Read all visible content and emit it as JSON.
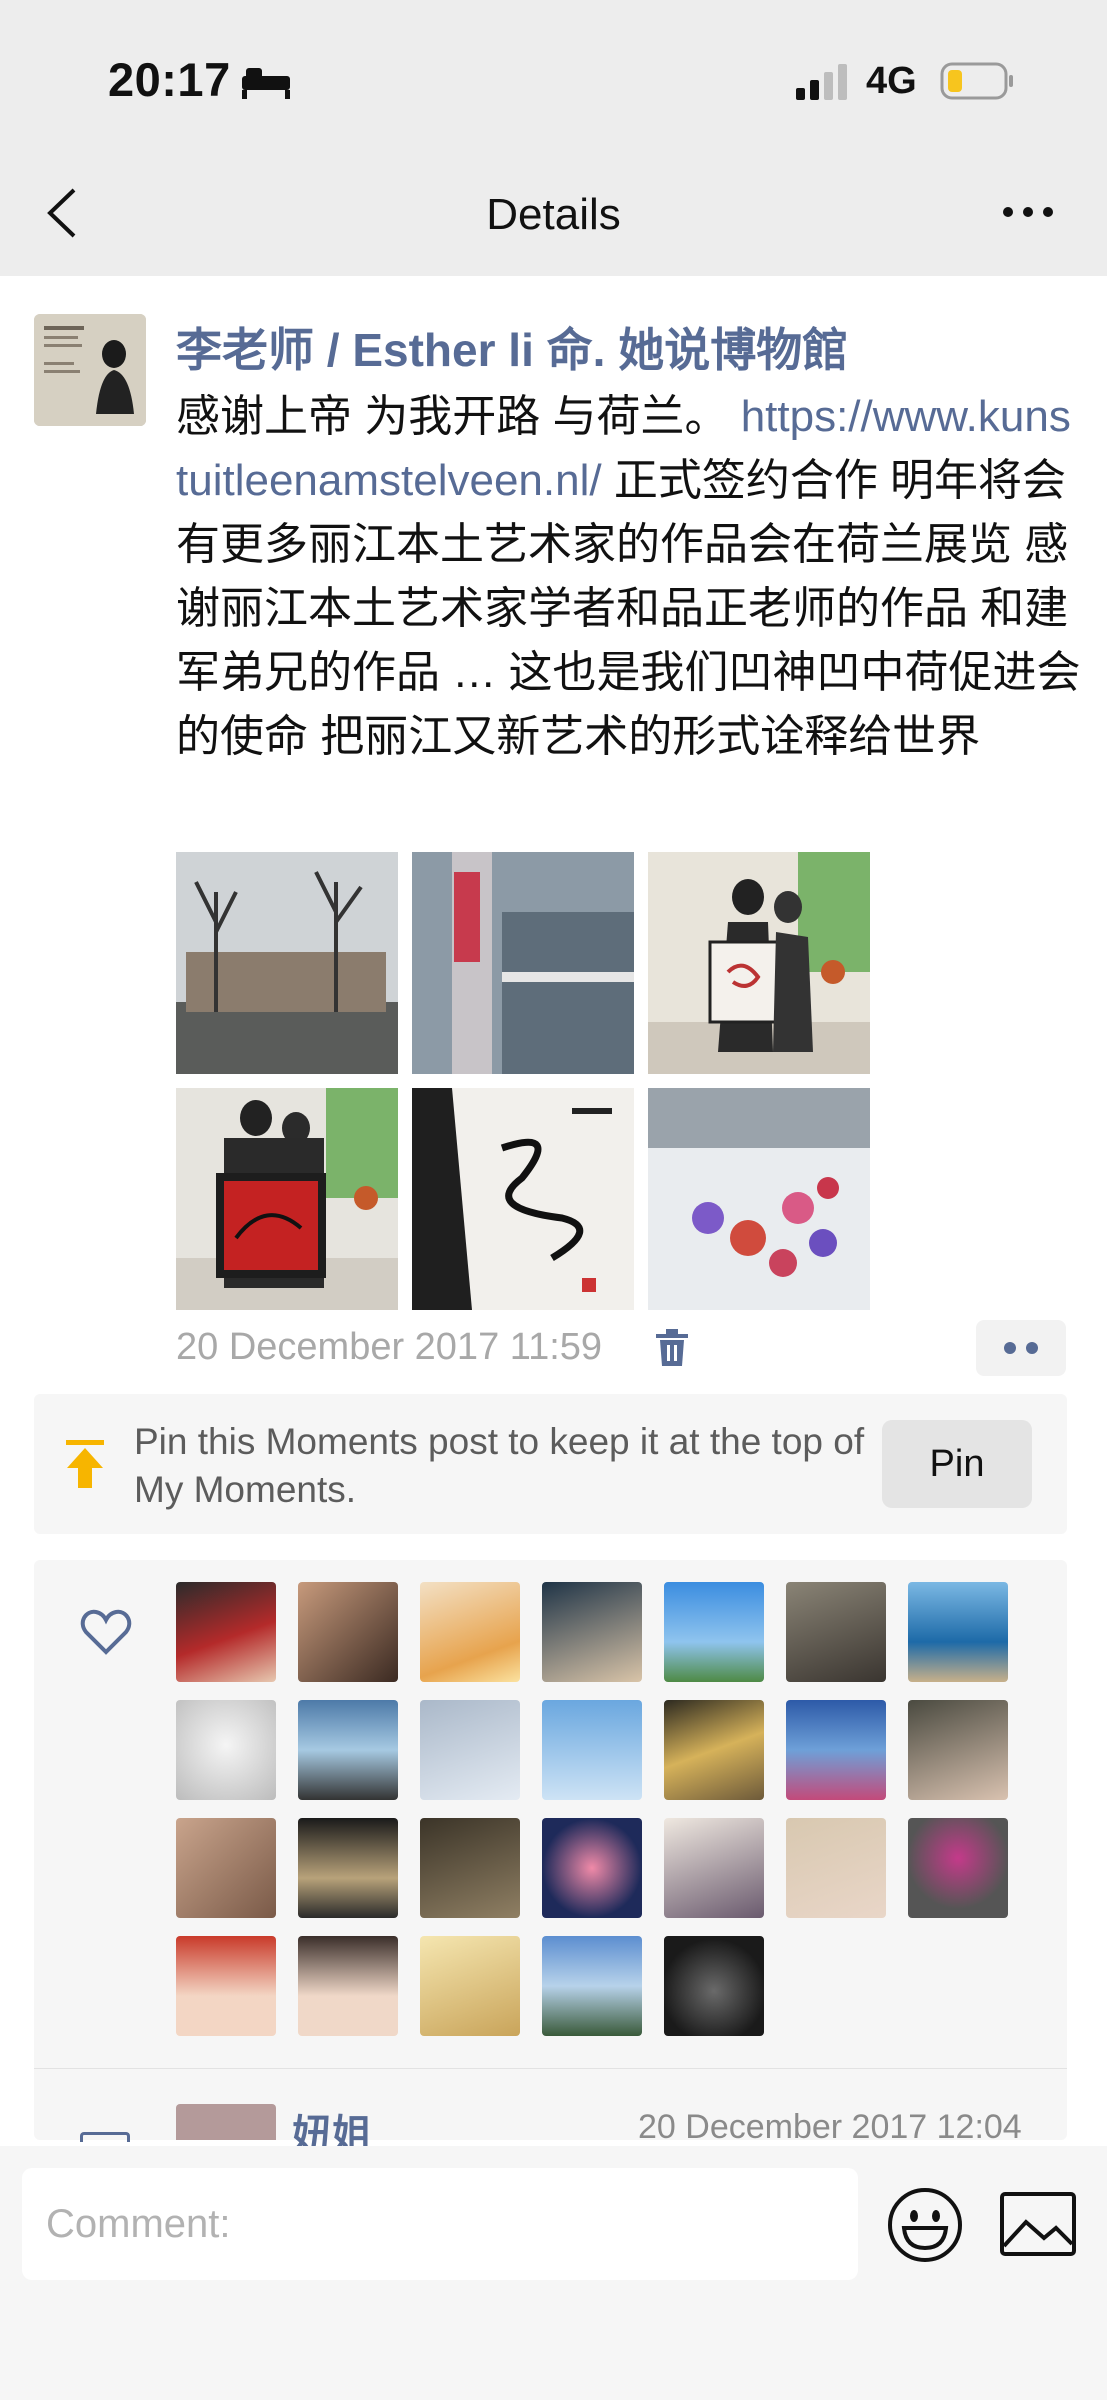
{
  "status_bar": {
    "time": "20:17",
    "network": "4G",
    "icons": [
      "bed-icon",
      "signal-icon",
      "battery-icon"
    ]
  },
  "nav": {
    "title": "Details",
    "back_icon": "chevron-left-icon",
    "more_icon": "more-icon"
  },
  "post": {
    "author": "李老师 / Esther li 命. 她说博物館",
    "text_before_link": "感谢上帝 为我开路 与荷兰。 ",
    "link": "https://www.kunstuitleenamstelveen.nl/",
    "text_after_link": " 正式签约合作 明年将会有更多丽江本土艺术家的作品会在荷兰展览 感谢丽江本土艺术家学者和品正老师的作品 和建军弟兄的作品 … 这也是我们凹神凹中荷促进会的使命 把丽江又新艺术的形式诠释给世界",
    "images": [
      "photo-1",
      "photo-2",
      "photo-3",
      "photo-4",
      "photo-5",
      "photo-6"
    ],
    "timestamp": "20 December 2017 11:59"
  },
  "pin": {
    "text": "Pin this Moments post to keep it at the top of My Moments.",
    "button_label": "Pin"
  },
  "likes": {
    "count": 26
  },
  "comment": {
    "name": "妞姐",
    "time": "20 December 2017 12:04"
  },
  "comment_bar": {
    "placeholder": "Comment:"
  },
  "colors": {
    "link": "#576b95",
    "pin_accent": "#f7b500",
    "background": "#ededed"
  }
}
